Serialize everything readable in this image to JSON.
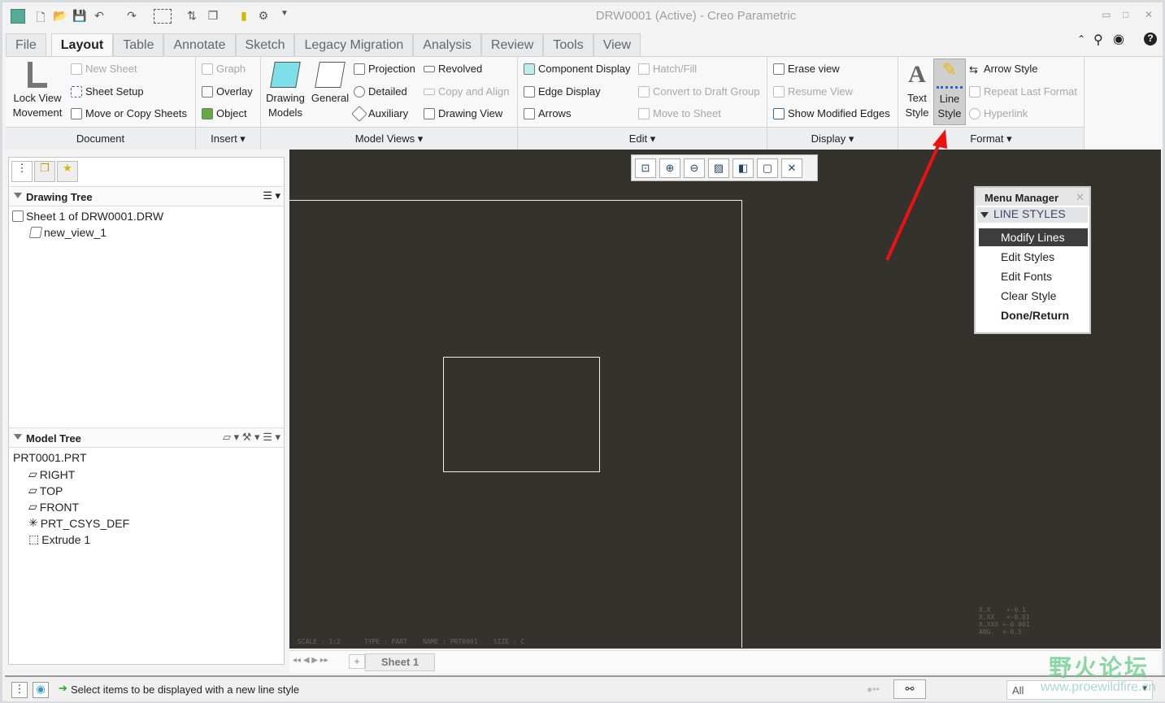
{
  "window": {
    "title": "DRW0001 (Active) - Creo Parametric"
  },
  "tabs": [
    "File",
    "Layout",
    "Table",
    "Annotate",
    "Sketch",
    "Legacy Migration",
    "Analysis",
    "Review",
    "Tools",
    "View"
  ],
  "ribbon": {
    "document": {
      "label": "Document",
      "lock_view": "Lock View",
      "lock_view2": "Movement",
      "new_sheet": "New Sheet",
      "sheet_setup": "Sheet Setup",
      "move_copy": "Move or Copy Sheets"
    },
    "insert": {
      "label": "Insert",
      "graph": "Graph",
      "overlay": "Overlay",
      "object": "Object"
    },
    "model_views": {
      "label": "Model Views",
      "drawing_models": "Drawing",
      "drawing_models2": "Models",
      "general": "General",
      "projection": "Projection",
      "detailed": "Detailed",
      "auxiliary": "Auxiliary",
      "revolved": "Revolved",
      "copy_align": "Copy and Align",
      "drawing_view": "Drawing View"
    },
    "edit": {
      "label": "Edit",
      "component_display": "Component Display",
      "edge_display": "Edge Display",
      "arrows": "Arrows",
      "hatch": "Hatch/Fill",
      "convert": "Convert to Draft Group",
      "move_sheet": "Move to Sheet"
    },
    "display": {
      "label": "Display",
      "erase": "Erase view",
      "resume": "Resume View",
      "show_modified": "Show Modified Edges"
    },
    "format": {
      "label": "Format",
      "text_style": "Text",
      "text_style2": "Style",
      "line_style": "Line",
      "line_style2": "Style",
      "arrow_style": "Arrow Style",
      "repeat": "Repeat Last Format",
      "hyperlink": "Hyperlink"
    }
  },
  "drawing_tree": {
    "title": "Drawing Tree",
    "items": [
      "Sheet 1 of DRW0001.DRW",
      "new_view_1"
    ]
  },
  "model_tree": {
    "title": "Model Tree",
    "items": [
      "PRT0001.PRT",
      "RIGHT",
      "TOP",
      "FRONT",
      "PRT_CSYS_DEF",
      "Extrude 1"
    ]
  },
  "canvas": {
    "format_text": "SCALE : 1:2      TYPE : PART    NAME : PRT0001    SIZE : C",
    "tolerances": [
      "X.X    +-0.1",
      "X.XX   +-0.01",
      "X.XXX +-0.001",
      "ANG.  +-0.5"
    ]
  },
  "menu_manager": {
    "title": "Menu Manager",
    "section": "LINE STYLES",
    "items": [
      "Modify Lines",
      "Edit Styles",
      "Edit Fonts",
      "Clear Style",
      "Done/Return"
    ]
  },
  "sheets": {
    "add": "+",
    "tab": "Sheet 1"
  },
  "status": {
    "message": "Select items to be displayed with a new line style",
    "filter": "All"
  },
  "watermark": {
    "text": "野火论坛",
    "url": "www.proewildfire.cn"
  },
  "colors": {
    "canvas": "#33322d",
    "highlight": "#3d3d3d",
    "arrow": "#ee1111"
  }
}
